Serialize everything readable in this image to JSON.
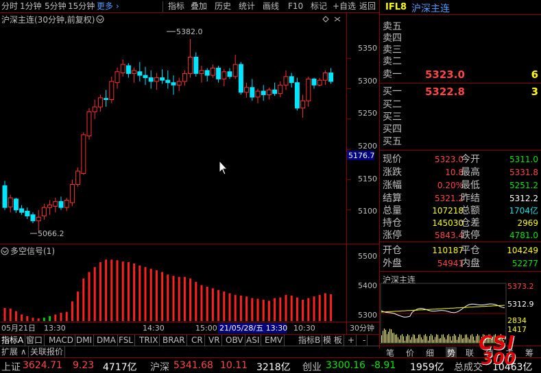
{
  "toolbar": {
    "items": [
      {
        "label": "分时",
        "active": false
      },
      {
        "label": "1分钟",
        "active": false
      },
      {
        "label": "5分钟",
        "active": false
      },
      {
        "label": "15分钟",
        "active": false
      },
      {
        "label": "更多",
        "active": false
      },
      {
        "label": "指标",
        "active": false
      },
      {
        "label": "叠加",
        "active": false
      },
      {
        "label": "历史",
        "active": false
      },
      {
        "label": "统计",
        "active": false
      },
      {
        "label": "画线",
        "active": false
      },
      {
        "label": "F10",
        "active": false
      },
      {
        "label": "标记",
        "active": false
      },
      {
        "label": "+自选",
        "active": false
      },
      {
        "label": "返回",
        "active": false
      }
    ],
    "more_arrow": "›"
  },
  "chart": {
    "title": "沪深主连(30分钟,前复权)",
    "max_label": "5382.0",
    "min_label": "5066.2",
    "cursor_price": "5176.7",
    "indicator_title": "多空信号(1)",
    "price_axis": [
      "5350",
      "5300",
      "5250",
      "5200",
      "5150",
      "5100"
    ],
    "ind_axis": [
      "5500",
      "5400",
      "5300"
    ],
    "time_labels": [
      "05月21日",
      "13:30",
      "14:30",
      "15:00",
      "10:30"
    ],
    "time_cursor": "21/05/28/五 13:30",
    "period": "30分钟"
  },
  "chart_data": {
    "type": "candlestick",
    "ohlc": [
      [
        5140,
        5148,
        5100,
        5104
      ],
      [
        5105,
        5125,
        5096,
        5120
      ],
      [
        5118,
        5120,
        5095,
        5100
      ],
      [
        5102,
        5108,
        5092,
        5096
      ],
      [
        5098,
        5104,
        5085,
        5090
      ],
      [
        5092,
        5096,
        5078,
        5082
      ],
      [
        5082,
        5100,
        5066,
        5088
      ],
      [
        5090,
        5110,
        5084,
        5104
      ],
      [
        5104,
        5116,
        5092,
        5108
      ],
      [
        5106,
        5120,
        5096,
        5114
      ],
      [
        5114,
        5122,
        5100,
        5104
      ],
      [
        5104,
        5120,
        5098,
        5116
      ],
      [
        5112,
        5150,
        5106,
        5142
      ],
      [
        5142,
        5170,
        5138,
        5164
      ],
      [
        5160,
        5228,
        5158,
        5224
      ],
      [
        5222,
        5268,
        5216,
        5262
      ],
      [
        5262,
        5282,
        5250,
        5270
      ],
      [
        5270,
        5290,
        5262,
        5285
      ],
      [
        5284,
        5298,
        5270,
        5282
      ],
      [
        5282,
        5320,
        5276,
        5312
      ],
      [
        5310,
        5335,
        5300,
        5328
      ],
      [
        5326,
        5348,
        5320,
        5340
      ],
      [
        5338,
        5342,
        5318,
        5325
      ],
      [
        5325,
        5335,
        5310,
        5330
      ],
      [
        5328,
        5344,
        5312,
        5322
      ],
      [
        5322,
        5336,
        5306,
        5318
      ],
      [
        5318,
        5330,
        5300,
        5312
      ],
      [
        5312,
        5326,
        5298,
        5318
      ],
      [
        5318,
        5332,
        5308,
        5314
      ],
      [
        5314,
        5330,
        5300,
        5310
      ],
      [
        5310,
        5322,
        5290,
        5306
      ],
      [
        5306,
        5318,
        5296,
        5312
      ],
      [
        5312,
        5330,
        5305,
        5325
      ],
      [
        5325,
        5382,
        5318,
        5352
      ],
      [
        5352,
        5360,
        5320,
        5325
      ],
      [
        5325,
        5338,
        5310,
        5330
      ],
      [
        5330,
        5334,
        5312,
        5322
      ],
      [
        5322,
        5340,
        5318,
        5334
      ],
      [
        5334,
        5338,
        5310,
        5316
      ],
      [
        5316,
        5332,
        5304,
        5328
      ],
      [
        5328,
        5334,
        5316,
        5320
      ],
      [
        5320,
        5356,
        5316,
        5340
      ],
      [
        5340,
        5344,
        5290,
        5294
      ],
      [
        5294,
        5310,
        5285,
        5302
      ],
      [
        5302,
        5316,
        5280,
        5286
      ],
      [
        5286,
        5300,
        5276,
        5296
      ],
      [
        5296,
        5306,
        5280,
        5290
      ],
      [
        5290,
        5302,
        5282,
        5298
      ],
      [
        5298,
        5310,
        5288,
        5292
      ],
      [
        5292,
        5312,
        5286,
        5306
      ],
      [
        5306,
        5330,
        5298,
        5320
      ],
      [
        5320,
        5326,
        5302,
        5310
      ],
      [
        5310,
        5318,
        5264,
        5268
      ],
      [
        5268,
        5290,
        5252,
        5280
      ],
      [
        5280,
        5320,
        5270,
        5316
      ],
      [
        5316,
        5318,
        5300,
        5306
      ],
      [
        5306,
        5318,
        5304,
        5314
      ],
      [
        5314,
        5330,
        5306,
        5326
      ],
      [
        5326,
        5334,
        5308,
        5312
      ]
    ],
    "signal": [
      5330,
      5328,
      5320,
      5310,
      5305,
      5300,
      5298,
      5300,
      5305,
      5310,
      5315,
      5318,
      5350,
      5380,
      5420,
      5440,
      5455,
      5470,
      5478,
      5478,
      5476,
      5472,
      5470,
      5466,
      5460,
      5455,
      5450,
      5445,
      5440,
      5432,
      5428,
      5425,
      5425,
      5420,
      5410,
      5400,
      5395,
      5390,
      5385,
      5380,
      5375,
      5370,
      5368,
      5365,
      5360,
      5358,
      5355,
      5352,
      5360,
      5362,
      5370,
      5368,
      5362,
      5355,
      5360,
      5365,
      5370,
      5375,
      5372
    ],
    "signal_colors": [
      "red",
      "red",
      "red",
      "red",
      "red",
      "red",
      "red",
      "green",
      "green",
      "red",
      "red",
      "red",
      "red",
      "red",
      "red",
      "red",
      "red",
      "red",
      "red",
      "red",
      "red",
      "red",
      "red",
      "red",
      "red",
      "red",
      "red",
      "red",
      "red",
      "red",
      "red",
      "red",
      "red",
      "red",
      "red",
      "red",
      "red",
      "red",
      "red",
      "red",
      "red",
      "red",
      "red",
      "red",
      "red",
      "red",
      "red",
      "red",
      "red",
      "red",
      "red",
      "red",
      "red",
      "red",
      "red",
      "red",
      "red",
      "red",
      "red"
    ],
    "ylim": [
      5050,
      5400
    ],
    "ind_ylim": [
      5290,
      5510
    ]
  },
  "quote": {
    "code": "IFL8",
    "name": "沪深主连",
    "asks": [
      "卖五",
      "卖四",
      "卖三",
      "卖二",
      "卖一"
    ],
    "ask1_price": "5323.0",
    "ask1_vol": "6",
    "bids": [
      "买一",
      "买二",
      "买三",
      "买四",
      "买五"
    ],
    "bid1_price": "5322.8",
    "bid1_vol": "3",
    "fields": [
      {
        "l1": "现价",
        "v1": "5323.0",
        "c1": "red",
        "l2": "今开",
        "v2": "5311.0",
        "c2": "green"
      },
      {
        "l1": "涨跌",
        "v1": "10.8",
        "c1": "red",
        "l2": "最高",
        "v2": "5331.8",
        "c2": "red"
      },
      {
        "l1": "涨幅",
        "v1": "0.20%",
        "c1": "red",
        "l2": "最低",
        "v2": "5251.2",
        "c2": "green"
      },
      {
        "l1": "结算",
        "v1": "5321.2",
        "c1": "red",
        "l2": "昨结",
        "v2": "5312.2",
        "c2": "white"
      },
      {
        "l1": "总量",
        "v1": "107218",
        "c1": "yellow",
        "l2": "总额",
        "v2": "1704亿",
        "c2": "cyan"
      },
      {
        "l1": "持仓",
        "v1": "145030",
        "c1": "yellow",
        "l2": "仓差",
        "v2": "2969",
        "c2": "yellow"
      },
      {
        "l1": "涨停",
        "v1": "5843.4",
        "c1": "red",
        "l2": "跌停",
        "v2": "4781.0",
        "c2": "green"
      },
      {
        "l1": "开仓",
        "v1": "110187",
        "c1": "yellow",
        "l2": "平仓",
        "v2": "104249",
        "c2": "yellow"
      },
      {
        "l1": "外盘",
        "v1": "54941",
        "c1": "red",
        "l2": "内盘",
        "v2": "52277",
        "c2": "green"
      }
    ]
  },
  "mini": {
    "title": "沪深主连",
    "high": "5373.2",
    "price": "5312.9",
    "vol_high": "2834",
    "vol_mid": "1417"
  },
  "tabs": [
    "指标A",
    "窗口",
    "MACD",
    "DMI",
    "DMA",
    "FSL",
    "TRIX",
    "BRAR",
    "CR",
    "VR",
    "OBV",
    "ASI",
    "EMV",
    "指标B",
    "模 板",
    "+",
    "-"
  ],
  "subtabs": [
    "扩展 ∧",
    "关联报价"
  ],
  "rtabs": [
    "笔",
    "价",
    "细",
    "势",
    "联",
    "值",
    "主",
    "筹"
  ],
  "ticker": [
    {
      "name": "上证",
      "price": "3624.71",
      "chg": "9.23",
      "amt": "4717亿",
      "color": "red"
    },
    {
      "name": "沪深",
      "price": "5341.68",
      "chg": "10.11",
      "amt": "3218亿",
      "color": "red"
    },
    {
      "name": "创业",
      "price": "3300.16",
      "chg": "-8.91",
      "amt": "1959亿",
      "color": "green"
    },
    {
      "name": "总成交",
      "price": "10463亿",
      "chg": "",
      "amt": "",
      "color": "white"
    }
  ],
  "logo": {
    "top": "CSI",
    "bottom": "300"
  },
  "colors": {
    "up": "#ff3030",
    "down": "#00e5ff",
    "border": "#880000",
    "signal_up": "#ff2020",
    "signal_down": "#00cc00"
  }
}
